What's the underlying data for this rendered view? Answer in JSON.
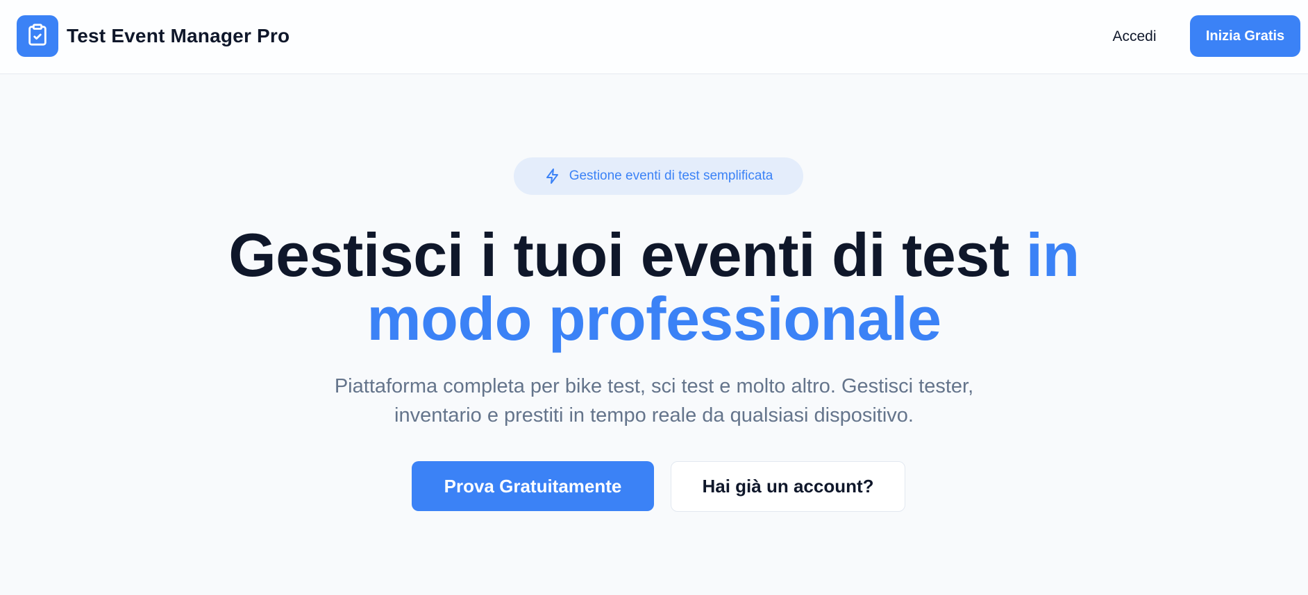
{
  "header": {
    "brand": "Test Event Manager Pro",
    "logo_icon": "clipboard-check-icon",
    "login_label": "Accedi",
    "cta_label": "Inizia Gratis"
  },
  "hero": {
    "badge": {
      "icon": "lightning-icon",
      "text": "Gestione eventi di test semplificata"
    },
    "title_main": "Gestisci i tuoi eventi di test ",
    "title_accent": "in modo professionale",
    "subtitle": "Piattaforma completa per bike test, sci test e molto altro. Gestisci tester, inventario e prestiti in tempo reale da qualsiasi dispositivo.",
    "primary_button": "Prova Gratuitamente",
    "secondary_button": "Hai già un account?"
  },
  "colors": {
    "accent": "#3b82f6",
    "text_dark": "#0f172a",
    "text_muted": "#64748b",
    "background": "#f8fafc",
    "badge_background": "#e4edfb"
  }
}
